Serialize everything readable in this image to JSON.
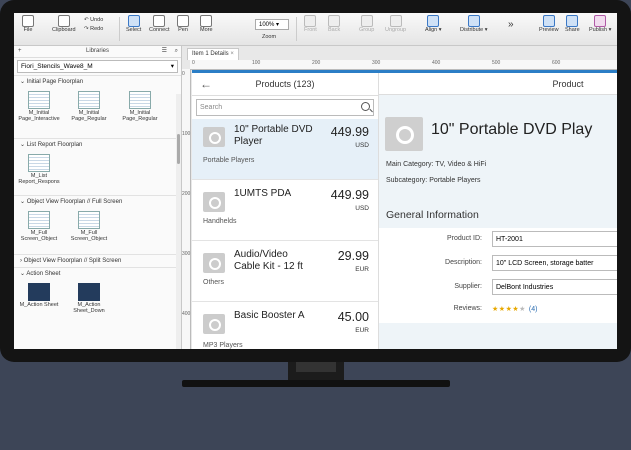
{
  "toolbar": {
    "file": "File",
    "clipboard": "Clipboard",
    "undo": "Undo",
    "redo": "Redo",
    "select": "Select",
    "connect": "Connect",
    "pen": "Pen",
    "more": "More",
    "zoom_value": "100%",
    "zoom": "Zoom",
    "front": "Front",
    "back": "Back",
    "group": "Group",
    "ungroup": "Ungroup",
    "align": "Align",
    "distribute": "Distribute",
    "preview": "Preview",
    "share": "Share",
    "publish": "Publish"
  },
  "library": {
    "title": "Libraries",
    "selected": "Fiori_Stencils_Wave8_M",
    "sections": [
      {
        "title": "Initial Page Floorplan",
        "items": [
          "M_Initial Page_Interactive",
          "M_Initial Page_Regular",
          "M_Initial Page_Regular"
        ]
      },
      {
        "title": "List Report Floorplan",
        "items": [
          "M_List Report_Respons"
        ]
      },
      {
        "title": "Object View Floorplan // Full Screen",
        "items": [
          "M_Full Screen_Object",
          "M_Full Screen_Object"
        ]
      },
      {
        "title": "Object View Floorplan // Split Screen",
        "items": []
      },
      {
        "title": "Action Sheet",
        "items": [
          "M_Action Sheet",
          "M_Action Sheet_Down"
        ]
      }
    ]
  },
  "canvas": {
    "tab": "Item 1 Details",
    "ruler_h": [
      "0",
      "100",
      "200",
      "300",
      "400",
      "500",
      "600"
    ],
    "ruler_v": [
      "0",
      "100",
      "200",
      "300",
      "400"
    ]
  },
  "master": {
    "title": "Products (123)",
    "search_placeholder": "Search",
    "items": [
      {
        "name": "10\" Portable DVD Player",
        "price": "449.99",
        "currency": "USD",
        "category": "Portable Players"
      },
      {
        "name": "1UMTS PDA",
        "price": "449.99",
        "currency": "USD",
        "category": "Handhelds"
      },
      {
        "name": "Audio/Video Cable Kit - 12 ft",
        "price": "29.99",
        "currency": "EUR",
        "category": "Others"
      },
      {
        "name": "Basic Booster A",
        "price": "45.00",
        "currency": "EUR",
        "category": "MP3 Players"
      }
    ]
  },
  "detail": {
    "title": "Product",
    "product_title": "10\" Portable DVD Play",
    "main_category": "Main Category: TV, Video & HiFi",
    "subcategory": "Subcategory: Portable Players",
    "section_title": "General Information",
    "fields": [
      {
        "label": "Product ID:",
        "value": "HT-2001"
      },
      {
        "label": "Description:",
        "value": "10\" LCD Screen, storage batter"
      },
      {
        "label": "Supplier:",
        "value": "DelBont Industries"
      }
    ],
    "reviews_label": "Reviews:",
    "rating": 4,
    "rating_max": 5,
    "reviews_count": "(4)"
  }
}
